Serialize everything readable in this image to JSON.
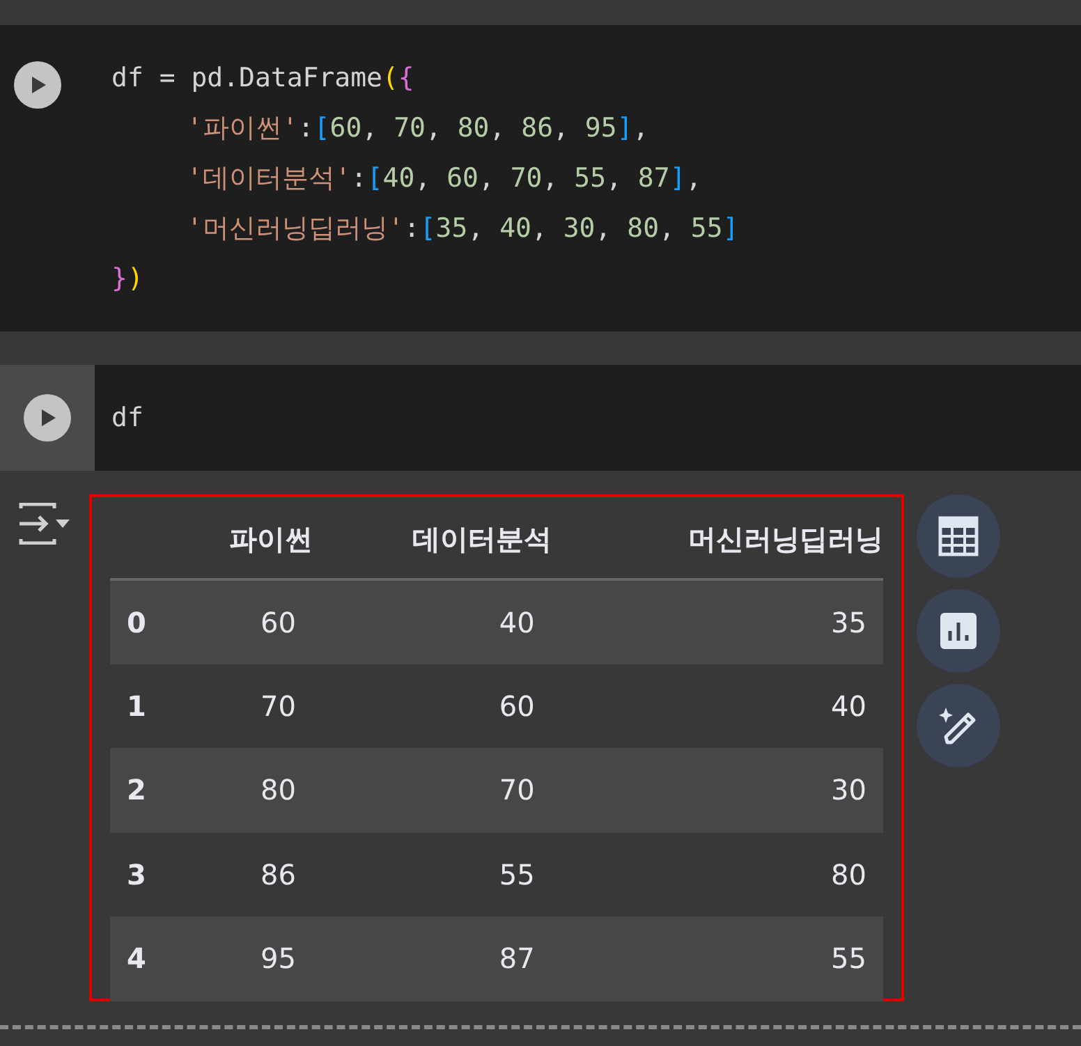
{
  "code_cells": [
    {
      "lines": [
        [
          {
            "kind": "plain",
            "text": "df = pd.DataFrame"
          },
          {
            "kind": "bracket1",
            "text": "("
          },
          {
            "kind": "bracket2",
            "text": "{"
          }
        ],
        [
          {
            "kind": "indent"
          },
          {
            "kind": "string",
            "text": "'파이썬'"
          },
          {
            "kind": "plain",
            "text": ":"
          },
          {
            "kind": "bracket3",
            "text": "["
          },
          {
            "kind": "number",
            "text": "60"
          },
          {
            "kind": "plain",
            "text": ", "
          },
          {
            "kind": "number",
            "text": "70"
          },
          {
            "kind": "plain",
            "text": ", "
          },
          {
            "kind": "number",
            "text": "80"
          },
          {
            "kind": "plain",
            "text": ", "
          },
          {
            "kind": "number",
            "text": "86"
          },
          {
            "kind": "plain",
            "text": ", "
          },
          {
            "kind": "number",
            "text": "95"
          },
          {
            "kind": "bracket3",
            "text": "]"
          },
          {
            "kind": "plain",
            "text": ","
          }
        ],
        [
          {
            "kind": "indent"
          },
          {
            "kind": "string",
            "text": "'데이터분석'"
          },
          {
            "kind": "plain",
            "text": ":"
          },
          {
            "kind": "bracket3",
            "text": "["
          },
          {
            "kind": "number",
            "text": "40"
          },
          {
            "kind": "plain",
            "text": ", "
          },
          {
            "kind": "number",
            "text": "60"
          },
          {
            "kind": "plain",
            "text": ", "
          },
          {
            "kind": "number",
            "text": "70"
          },
          {
            "kind": "plain",
            "text": ", "
          },
          {
            "kind": "number",
            "text": "55"
          },
          {
            "kind": "plain",
            "text": ", "
          },
          {
            "kind": "number",
            "text": "87"
          },
          {
            "kind": "bracket3",
            "text": "]"
          },
          {
            "kind": "plain",
            "text": ","
          }
        ],
        [
          {
            "kind": "indent"
          },
          {
            "kind": "string",
            "text": "'머신러닝딥러닝'"
          },
          {
            "kind": "plain",
            "text": ":"
          },
          {
            "kind": "bracket3",
            "text": "["
          },
          {
            "kind": "number",
            "text": "35"
          },
          {
            "kind": "plain",
            "text": ", "
          },
          {
            "kind": "number",
            "text": "40"
          },
          {
            "kind": "plain",
            "text": ", "
          },
          {
            "kind": "number",
            "text": "30"
          },
          {
            "kind": "plain",
            "text": ", "
          },
          {
            "kind": "number",
            "text": "80"
          },
          {
            "kind": "plain",
            "text": ", "
          },
          {
            "kind": "number",
            "text": "55"
          },
          {
            "kind": "bracket3",
            "text": "]"
          }
        ],
        [
          {
            "kind": "bracket2",
            "text": "}"
          },
          {
            "kind": "bracket1",
            "text": ")"
          }
        ]
      ]
    },
    {
      "lines": [
        [
          {
            "kind": "plain",
            "text": "df"
          }
        ]
      ]
    }
  ],
  "output": {
    "table": {
      "columns": [
        "파이썬",
        "데이터분석",
        "머신러닝딥러닝"
      ],
      "rows": [
        {
          "index": "0",
          "cells": [
            "60",
            "40",
            "35"
          ]
        },
        {
          "index": "1",
          "cells": [
            "70",
            "60",
            "40"
          ]
        },
        {
          "index": "2",
          "cells": [
            "80",
            "70",
            "30"
          ]
        },
        {
          "index": "3",
          "cells": [
            "86",
            "55",
            "80"
          ]
        },
        {
          "index": "4",
          "cells": [
            "95",
            "87",
            "55"
          ]
        }
      ]
    }
  }
}
